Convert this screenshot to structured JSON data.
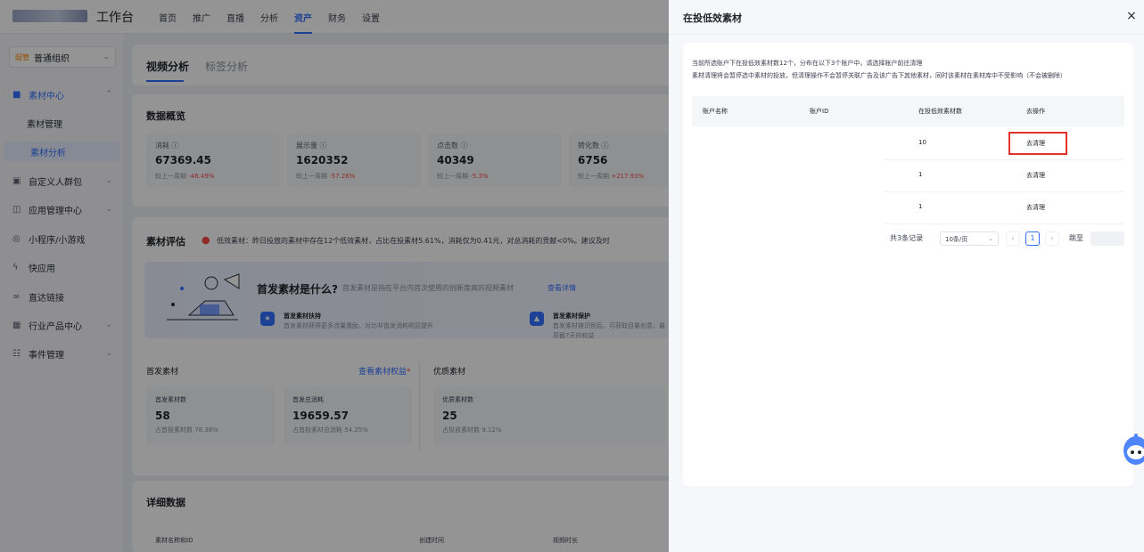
{
  "header": {
    "brand": "工作台",
    "nav": [
      "首页",
      "推广",
      "直播",
      "分析",
      "资产",
      "财务",
      "设置"
    ],
    "active_nav": "资产"
  },
  "sidebar": {
    "org": {
      "tag": "超管",
      "name": "普通组织"
    },
    "items": [
      {
        "label": "素材中心",
        "icon": "video-icon"
      },
      {
        "label": "素材管理"
      },
      {
        "label": "素材分析"
      },
      {
        "label": "自定义人群包",
        "icon": "audience-icon"
      },
      {
        "label": "应用管理中心",
        "icon": "app-icon"
      },
      {
        "label": "小程序/小游戏",
        "icon": "miniprogram-icon"
      },
      {
        "label": "快应用",
        "icon": "quickapp-icon"
      },
      {
        "label": "直达链接",
        "icon": "link-icon"
      },
      {
        "label": "行业产品中心",
        "icon": "grid-icon"
      },
      {
        "label": "事件管理",
        "icon": "event-icon"
      }
    ]
  },
  "main": {
    "tabs": [
      "视频分析",
      "标签分析"
    ],
    "overview": {
      "title": "数据概览",
      "compare_label": "较上一周期",
      "metrics": [
        {
          "label": "消耗",
          "value": "67369.45",
          "change": "-46.49%"
        },
        {
          "label": "展示量",
          "value": "1620352",
          "change": "-57.26%"
        },
        {
          "label": "点击数",
          "value": "40349",
          "change": "-5.3%"
        },
        {
          "label": "转化数",
          "value": "6756",
          "change": "+217.93%"
        }
      ]
    },
    "evaluation": {
      "title": "素材评估",
      "warning": "低效素材：昨日投放的素材中存在12个低效素材，占比在投素材5.61%，消耗仅为0.41元，对总消耗的贡献<0%。建议及时",
      "banner": {
        "title": "首发素材是什么?",
        "desc": "首发素材是指在平台内首次使用的创新度高的视频素材",
        "link": "查看详情",
        "features": [
          {
            "title": "首发素材扶持",
            "desc": "首发素材获得更多流量激励，对比非首发消耗明显提升"
          },
          {
            "title": "首发素材保护",
            "desc": "首发素材被识别后，可获取目量创意，最",
            "desc2": "原截7天的权益"
          }
        ]
      },
      "first": {
        "title": "首发素材",
        "link": "查看素材权益",
        "cards": [
          {
            "label": "首发素材数",
            "value": "58",
            "sub": "占首投素材数 78.38%"
          },
          {
            "label": "首发总消耗",
            "value": "19659.57",
            "sub": "占首投素材总消耗 54.25%"
          }
        ]
      },
      "quality": {
        "title": "优质素材",
        "cards": [
          {
            "label": "优质素材数",
            "value": "25",
            "sub": "占投放素材数 9.12%"
          }
        ]
      }
    },
    "detail": {
      "title": "详细数据",
      "columns": [
        "素材名称和ID",
        "创建时间",
        "视频时长"
      ]
    }
  },
  "drawer": {
    "title": "在投低效素材",
    "close": "×",
    "note1": "当前所选账户下在投低效素材数12个，分布在以下3个账户中，请选择账户前往清理",
    "note2": "素材清理将会暂停选中素材的投放，但清理操作不会暂停关联广告及该广告下其他素材，同时该素材在素材库中不受影响（不会被删除）",
    "columns": [
      "账户名称",
      "账户ID",
      "在投低效素材数",
      "去操作"
    ],
    "rows": [
      {
        "count": "10",
        "action": "去清理"
      },
      {
        "count": "1",
        "action": "去清理"
      },
      {
        "count": "1",
        "action": "去清理"
      }
    ],
    "pagination": {
      "total": "共3条记录",
      "page_size": "10条/页",
      "prev": "‹",
      "current": "1",
      "next": "›",
      "jump_label": "跳至"
    }
  },
  "colors": {
    "accent": "#3370ff",
    "danger": "#f54a45",
    "highlight_box": "#e5322d"
  }
}
